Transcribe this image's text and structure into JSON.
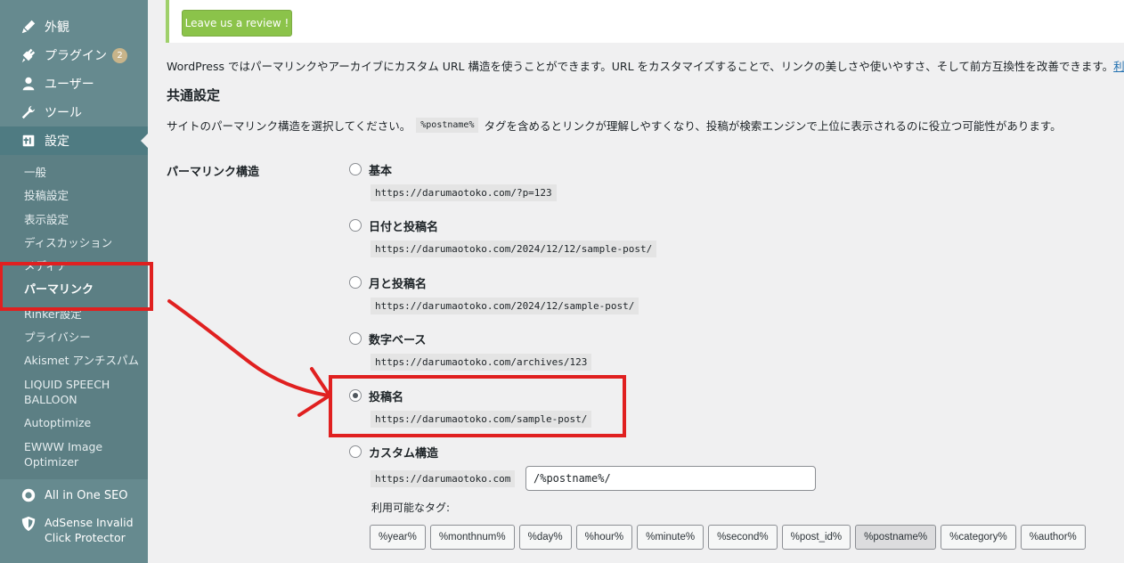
{
  "sidebar": {
    "menu": [
      {
        "label": "外観",
        "icon": "paintbrush-icon"
      },
      {
        "label": "プラグイン",
        "icon": "plugin-icon",
        "badge": "2"
      },
      {
        "label": "ユーザー",
        "icon": "user-icon"
      },
      {
        "label": "ツール",
        "icon": "wrench-icon"
      },
      {
        "label": "設定",
        "icon": "settings-icon"
      }
    ],
    "submenu": [
      {
        "label": "一般"
      },
      {
        "label": "投稿設定"
      },
      {
        "label": "表示設定"
      },
      {
        "label": "ディスカッション"
      },
      {
        "label": "メディア"
      },
      {
        "label": "パーマリンク"
      },
      {
        "label": "Rinker設定"
      },
      {
        "label": "プライバシー"
      },
      {
        "label": "Akismet アンチスパム"
      },
      {
        "label": "LIQUID SPEECH BALLOON"
      },
      {
        "label": "Autoptimize"
      },
      {
        "label": "EWWW Image Optimizer"
      }
    ],
    "plugins": [
      {
        "label": "All in One SEO",
        "icon": "aioseo-icon"
      },
      {
        "label": "AdSense Invalid Click Protector",
        "icon": "shield-icon"
      }
    ]
  },
  "notice": {
    "button_label": "Leave us a review !"
  },
  "intro": {
    "text": "WordPress ではパーマリンクやアーカイブにカスタム URL 構造を使うことができます。URL をカスタマイズすることで、リンクの美しさや使いやすさ、そして前方互換性を改善できます。",
    "link_text": "利用でき"
  },
  "section": {
    "title": "共通設定",
    "desc_before": "サイトのパーマリンク構造を選択してください。",
    "desc_code": "%postname%",
    "desc_after": "タグを含めるとリンクが理解しやすくなり、投稿が検索エンジンで上位に表示されるのに役立つ可能性があります。"
  },
  "permalink": {
    "field_label": "パーマリンク構造",
    "options": [
      {
        "label": "基本",
        "example": "https://darumaotoko.com/?p=123",
        "checked": false
      },
      {
        "label": "日付と投稿名",
        "example": "https://darumaotoko.com/2024/12/12/sample-post/",
        "checked": false
      },
      {
        "label": "月と投稿名",
        "example": "https://darumaotoko.com/2024/12/sample-post/",
        "checked": false
      },
      {
        "label": "数字ベース",
        "example": "https://darumaotoko.com/archives/123",
        "checked": false
      },
      {
        "label": "投稿名",
        "example": "https://darumaotoko.com/sample-post/",
        "checked": true
      },
      {
        "label": "カスタム構造",
        "checked": false
      }
    ],
    "custom_prefix": "https://darumaotoko.com",
    "custom_value": "/%postname%/",
    "tags_label": "利用可能なタグ:",
    "tags": [
      "%year%",
      "%monthnum%",
      "%day%",
      "%hour%",
      "%minute%",
      "%second%",
      "%post_id%",
      "%postname%",
      "%category%",
      "%author%"
    ],
    "active_tag": "%postname%"
  },
  "annotation_color": "#e02020"
}
